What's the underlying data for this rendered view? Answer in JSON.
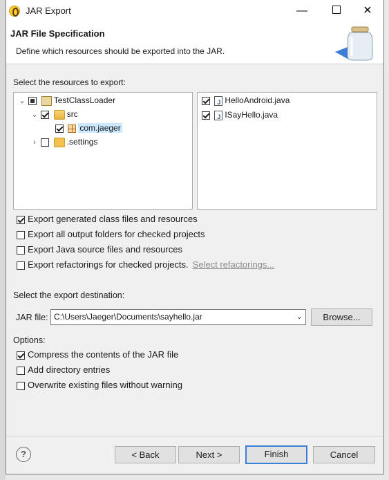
{
  "window": {
    "title": "JAR Export",
    "minimize_icon": "minimize-icon",
    "maximize_icon": "maximize-icon",
    "close_icon": "close-icon"
  },
  "header": {
    "title": "JAR File Specification",
    "description": "Define which resources should be exported into the JAR."
  },
  "resources": {
    "label": "Select the resources to export:",
    "tree": [
      {
        "label": "TestClassLoader",
        "state": "partial",
        "expanded": true,
        "icon": "project-icon"
      },
      {
        "label": "src",
        "state": "checked",
        "expanded": true,
        "icon": "source-folder-icon"
      },
      {
        "label": "com.jaeger",
        "state": "checked",
        "selected": true,
        "icon": "package-icon"
      },
      {
        "label": ".settings",
        "state": "unchecked",
        "expanded": false,
        "icon": "folder-icon"
      }
    ],
    "files": [
      {
        "label": "HelloAndroid.java",
        "state": "checked",
        "icon": "java-file-icon"
      },
      {
        "label": "ISayHello.java",
        "state": "checked",
        "icon": "java-file-icon"
      }
    ]
  },
  "export_options": [
    {
      "label": "Export generated class files and resources",
      "checked": true
    },
    {
      "label": "Export all output folders for checked projects",
      "checked": false
    },
    {
      "label": "Export Java source files and resources",
      "checked": false
    },
    {
      "label": "Export refactorings for checked projects.",
      "checked": false,
      "link": "Select refactorings..."
    }
  ],
  "destination": {
    "label": "Select the export destination:",
    "jar_label": "JAR file:",
    "jar_path": "C:\\Users\\Jaeger\\Documents\\sayhello.jar",
    "browse_label": "Browse..."
  },
  "options": {
    "label": "Options:",
    "items": [
      {
        "label": "Compress the contents of the JAR file",
        "checked": true
      },
      {
        "label": "Add directory entries",
        "checked": false
      },
      {
        "label": "Overwrite existing files without warning",
        "checked": false
      }
    ]
  },
  "footer": {
    "help_icon": "help-icon",
    "help_symbol": "?",
    "back_label": "< Back",
    "next_label": "Next >",
    "finish_label": "Finish",
    "cancel_label": "Cancel"
  }
}
